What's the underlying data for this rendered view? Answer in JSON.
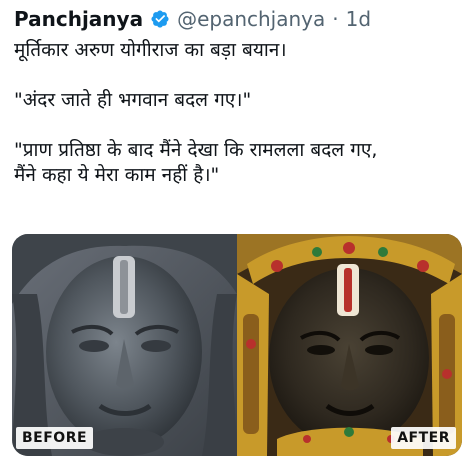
{
  "tweet": {
    "author_name": "Panchjanya",
    "handle": "@epanchjanya",
    "separator": "·",
    "time": "1d",
    "lines": [
      "मूर्तिकार अरुण योगीराज का बड़ा बयान।",
      "\"अंदर जाते ही भगवान बदल गए।\"",
      "\"प्राण प्रतिष्ठा के बाद मैंने देखा कि रामलला बदल गए,",
      "मैंने कहा ये मेरा काम नहीं है।\""
    ]
  },
  "media": {
    "before_label": "BEFORE",
    "after_label": "AFTER"
  },
  "colors": {
    "verified": "#1d9bf0",
    "secondary_text": "#536471",
    "statue_stone": "#4a5158",
    "statue_dark": "#2b2620",
    "gold": "#c89a2a"
  }
}
